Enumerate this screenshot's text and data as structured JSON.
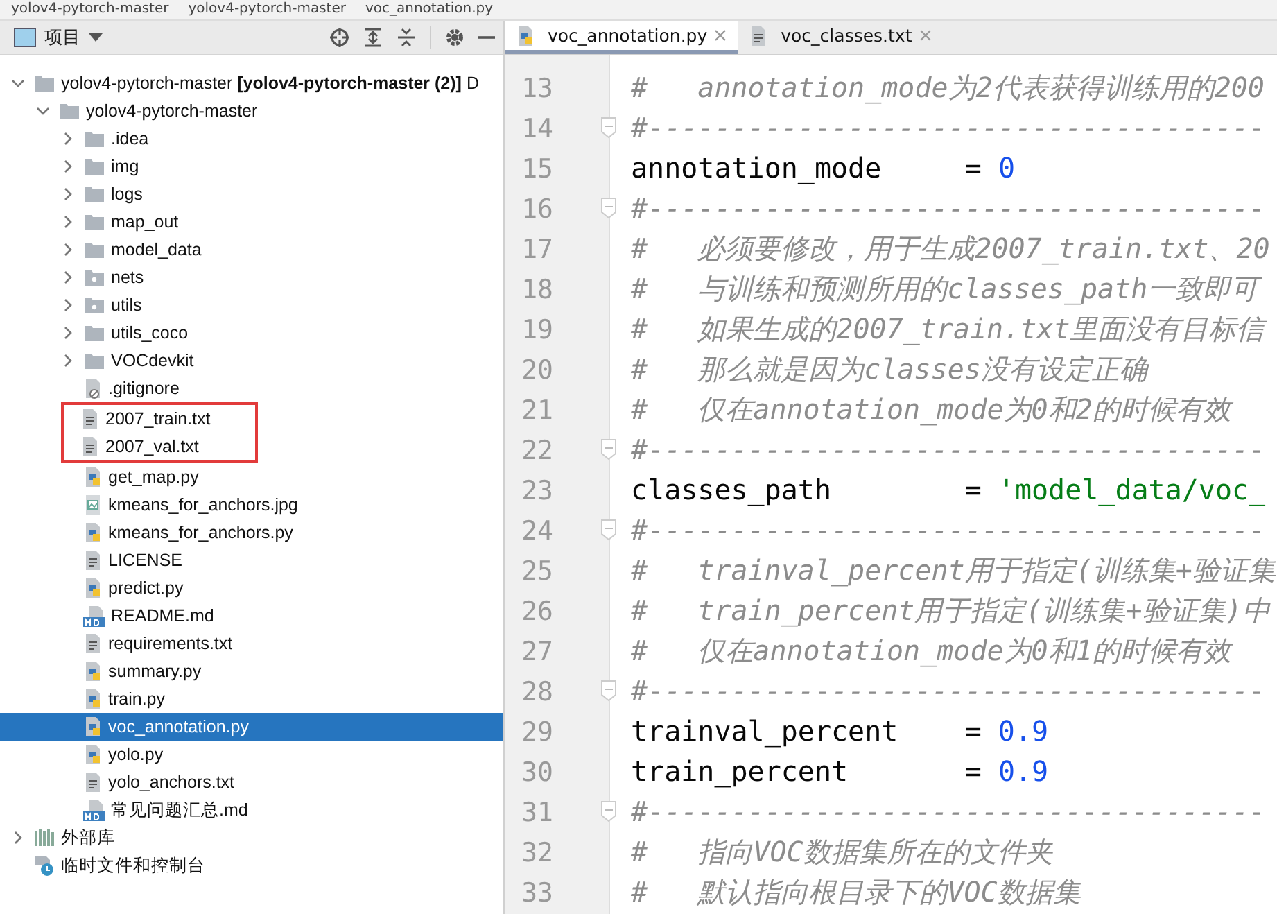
{
  "breadcrumb": [
    "yolov4-pytorch-master",
    "yolov4-pytorch-master",
    "voc_annotation.py"
  ],
  "project_panel": {
    "title": "项目",
    "tree": [
      {
        "label": "yolov4-pytorch-master **[yolov4-pytorch-master (2)]** D",
        "kind": "folder",
        "expanded": true,
        "selected": false,
        "children": [
          {
            "label": "yolov4-pytorch-master",
            "kind": "folder",
            "expanded": true,
            "selected": false,
            "children": [
              {
                "label": ".idea",
                "kind": "folder",
                "expanded": false,
                "selected": false
              },
              {
                "label": "img",
                "kind": "folder",
                "expanded": false,
                "selected": false
              },
              {
                "label": "logs",
                "kind": "folder",
                "expanded": false,
                "selected": false
              },
              {
                "label": "map_out",
                "kind": "folder",
                "expanded": false,
                "selected": false
              },
              {
                "label": "model_data",
                "kind": "folder",
                "expanded": false,
                "selected": false
              },
              {
                "label": "nets",
                "kind": "package",
                "expanded": false,
                "selected": false
              },
              {
                "label": "utils",
                "kind": "package",
                "expanded": false,
                "selected": false
              },
              {
                "label": "utils_coco",
                "kind": "folder",
                "expanded": false,
                "selected": false
              },
              {
                "label": "VOCdevkit",
                "kind": "folder",
                "expanded": false,
                "selected": false
              },
              {
                "label": ".gitignore",
                "kind": "ignore",
                "selected": false,
                "highlighted": false
              },
              {
                "label": "2007_train.txt",
                "kind": "text",
                "selected": false,
                "highlighted": true
              },
              {
                "label": "2007_val.txt",
                "kind": "text",
                "selected": false,
                "highlighted": true
              },
              {
                "label": "get_map.py",
                "kind": "python",
                "selected": false,
                "highlighted": false
              },
              {
                "label": "kmeans_for_anchors.jpg",
                "kind": "image",
                "selected": false,
                "highlighted": false
              },
              {
                "label": "kmeans_for_anchors.py",
                "kind": "python",
                "selected": false,
                "highlighted": false
              },
              {
                "label": "LICENSE",
                "kind": "text",
                "selected": false,
                "highlighted": false
              },
              {
                "label": "predict.py",
                "kind": "python",
                "selected": false,
                "highlighted": false
              },
              {
                "label": "README.md",
                "kind": "markdown",
                "selected": false,
                "highlighted": false
              },
              {
                "label": "requirements.txt",
                "kind": "text",
                "selected": false,
                "highlighted": false
              },
              {
                "label": "summary.py",
                "kind": "python",
                "selected": false,
                "highlighted": false
              },
              {
                "label": "train.py",
                "kind": "python",
                "selected": false,
                "highlighted": false
              },
              {
                "label": "voc_annotation.py",
                "kind": "python",
                "selected": true,
                "highlighted": false
              },
              {
                "label": "yolo.py",
                "kind": "python",
                "selected": false,
                "highlighted": false
              },
              {
                "label": "yolo_anchors.txt",
                "kind": "text",
                "selected": false,
                "highlighted": false
              },
              {
                "label": "常见问题汇总.md",
                "kind": "markdown",
                "selected": false,
                "highlighted": false
              }
            ]
          }
        ]
      },
      {
        "label": "外部库",
        "kind": "library",
        "expanded": false,
        "selected": false
      },
      {
        "label": "临时文件和控制台",
        "kind": "scratch",
        "selected": false
      }
    ]
  },
  "editor": {
    "tabs": [
      {
        "label": "voc_annotation.py",
        "kind": "python",
        "selected": true
      },
      {
        "label": "voc_classes.txt",
        "kind": "text",
        "selected": false
      }
    ],
    "lines": [
      {
        "number": "13",
        "kind": "comment",
        "text": "#   annotation_mode为2代表获得训练用的200"
      },
      {
        "number": "14",
        "kind": "separator",
        "text": "#-------------------------------------"
      },
      {
        "number": "15",
        "kind": "assign_number",
        "name": "annotation_mode",
        "op": "=",
        "value": "0"
      },
      {
        "number": "16",
        "kind": "separator",
        "text": "#-------------------------------------"
      },
      {
        "number": "17",
        "kind": "comment",
        "text": "#   必须要修改，用于生成2007_train.txt、20"
      },
      {
        "number": "18",
        "kind": "comment",
        "text": "#   与训练和预测所用的classes_path一致即可"
      },
      {
        "number": "19",
        "kind": "comment",
        "text": "#   如果生成的2007_train.txt里面没有目标信"
      },
      {
        "number": "20",
        "kind": "comment",
        "text": "#   那么就是因为classes没有设定正确"
      },
      {
        "number": "21",
        "kind": "comment",
        "text": "#   仅在annotation_mode为0和2的时候有效"
      },
      {
        "number": "22",
        "kind": "separator",
        "text": "#-------------------------------------"
      },
      {
        "number": "23",
        "kind": "assign_string",
        "name": "classes_path",
        "op": "=",
        "value": "'model_data/voc_"
      },
      {
        "number": "24",
        "kind": "separator",
        "text": "#-------------------------------------"
      },
      {
        "number": "25",
        "kind": "comment",
        "text": "#   trainval_percent用于指定(训练集+验证集"
      },
      {
        "number": "26",
        "kind": "comment",
        "text": "#   train_percent用于指定(训练集+验证集)中"
      },
      {
        "number": "27",
        "kind": "comment",
        "text": "#   仅在annotation_mode为0和1的时候有效"
      },
      {
        "number": "28",
        "kind": "separator",
        "text": "#-------------------------------------"
      },
      {
        "number": "29",
        "kind": "assign_number",
        "name": "trainval_percent",
        "op": "=",
        "value": "0.9"
      },
      {
        "number": "30",
        "kind": "assign_number",
        "name": "train_percent",
        "op": "=",
        "value": "0.9"
      },
      {
        "number": "31",
        "kind": "separator",
        "text": "#-------------------------------------"
      },
      {
        "number": "32",
        "kind": "comment",
        "text": "#   指向VOC数据集所在的文件夹"
      },
      {
        "number": "33",
        "kind": "comment",
        "text": "#   默认指向根目录下的VOC数据集"
      }
    ]
  }
}
